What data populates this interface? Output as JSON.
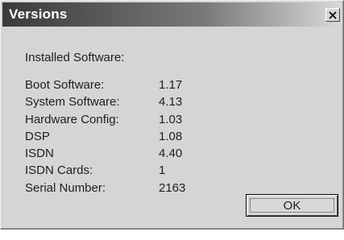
{
  "window": {
    "title": "Versions"
  },
  "close_icon": "close-icon",
  "section": {
    "label": "Installed Software:"
  },
  "items": [
    {
      "name": "Boot Software:",
      "value": "1.17"
    },
    {
      "name": "System Software:",
      "value": "4.13"
    },
    {
      "name": "Hardware Config:",
      "value": "1.03"
    },
    {
      "name": "DSP",
      "value": "1.08"
    },
    {
      "name": "ISDN",
      "value": "4.40"
    },
    {
      "name": "ISDN Cards:",
      "value": "1"
    },
    {
      "name": "Serial Number:",
      "value": "2163"
    }
  ],
  "buttons": {
    "ok_label": "OK"
  }
}
